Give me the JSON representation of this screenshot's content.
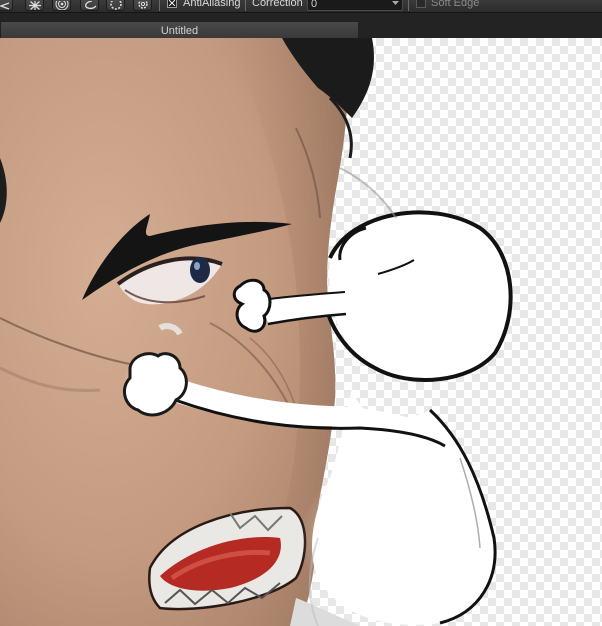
{
  "toolbar": {
    "tool_icons": [
      "arrow-left-icon",
      "starburst-icon",
      "concentric-circles-icon",
      "curve-icon",
      "dotted-circle-icon",
      "gear-icon"
    ],
    "antialiasing": {
      "label": "AntiAliasing",
      "checked": true
    },
    "correction": {
      "label": "Correction",
      "value": "0"
    },
    "soft_edge": {
      "label": "Soft Edge",
      "checked": false
    }
  },
  "document": {
    "tab_title": "Untitled"
  },
  "colors": {
    "skin": "#c89f84",
    "outline": "#111111",
    "ui_bar": "#2c2c2c",
    "transparency_check": "#e7e7e7"
  }
}
